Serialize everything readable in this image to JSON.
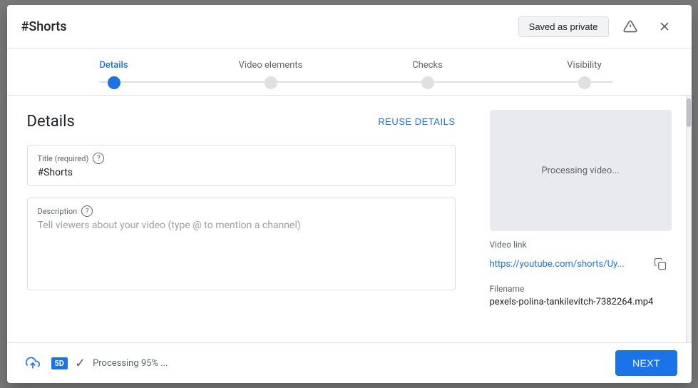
{
  "modal": {
    "title": "#Shorts",
    "saved_badge": "Saved as private",
    "close_label": "×"
  },
  "stepper": {
    "steps": [
      {
        "label": "Details",
        "active": true
      },
      {
        "label": "Video elements",
        "active": false
      },
      {
        "label": "Checks",
        "active": false
      },
      {
        "label": "Visibility",
        "active": false
      }
    ]
  },
  "details": {
    "section_title": "Details",
    "reuse_button": "REUSE DETAILS",
    "title_field": {
      "label": "Title (required)",
      "value": "#Shorts"
    },
    "description_field": {
      "label": "Description",
      "placeholder": "Tell viewers about your video (type @ to mention a channel)"
    }
  },
  "video_panel": {
    "processing_text": "Processing video...",
    "video_link_label": "Video link",
    "video_link_text": "https://youtube.com/shorts/Uy...",
    "filename_label": "Filename",
    "filename_text": "pexels-polina-tankilevitch-7382264.mp4"
  },
  "footer": {
    "processing_status": "Processing 95% ...",
    "next_button": "NEXT",
    "sd_badge": "5D"
  },
  "icons": {
    "alert": "!",
    "close": "✕",
    "help": "?",
    "copy": "⧉",
    "upload": "↑",
    "check": "✓"
  }
}
